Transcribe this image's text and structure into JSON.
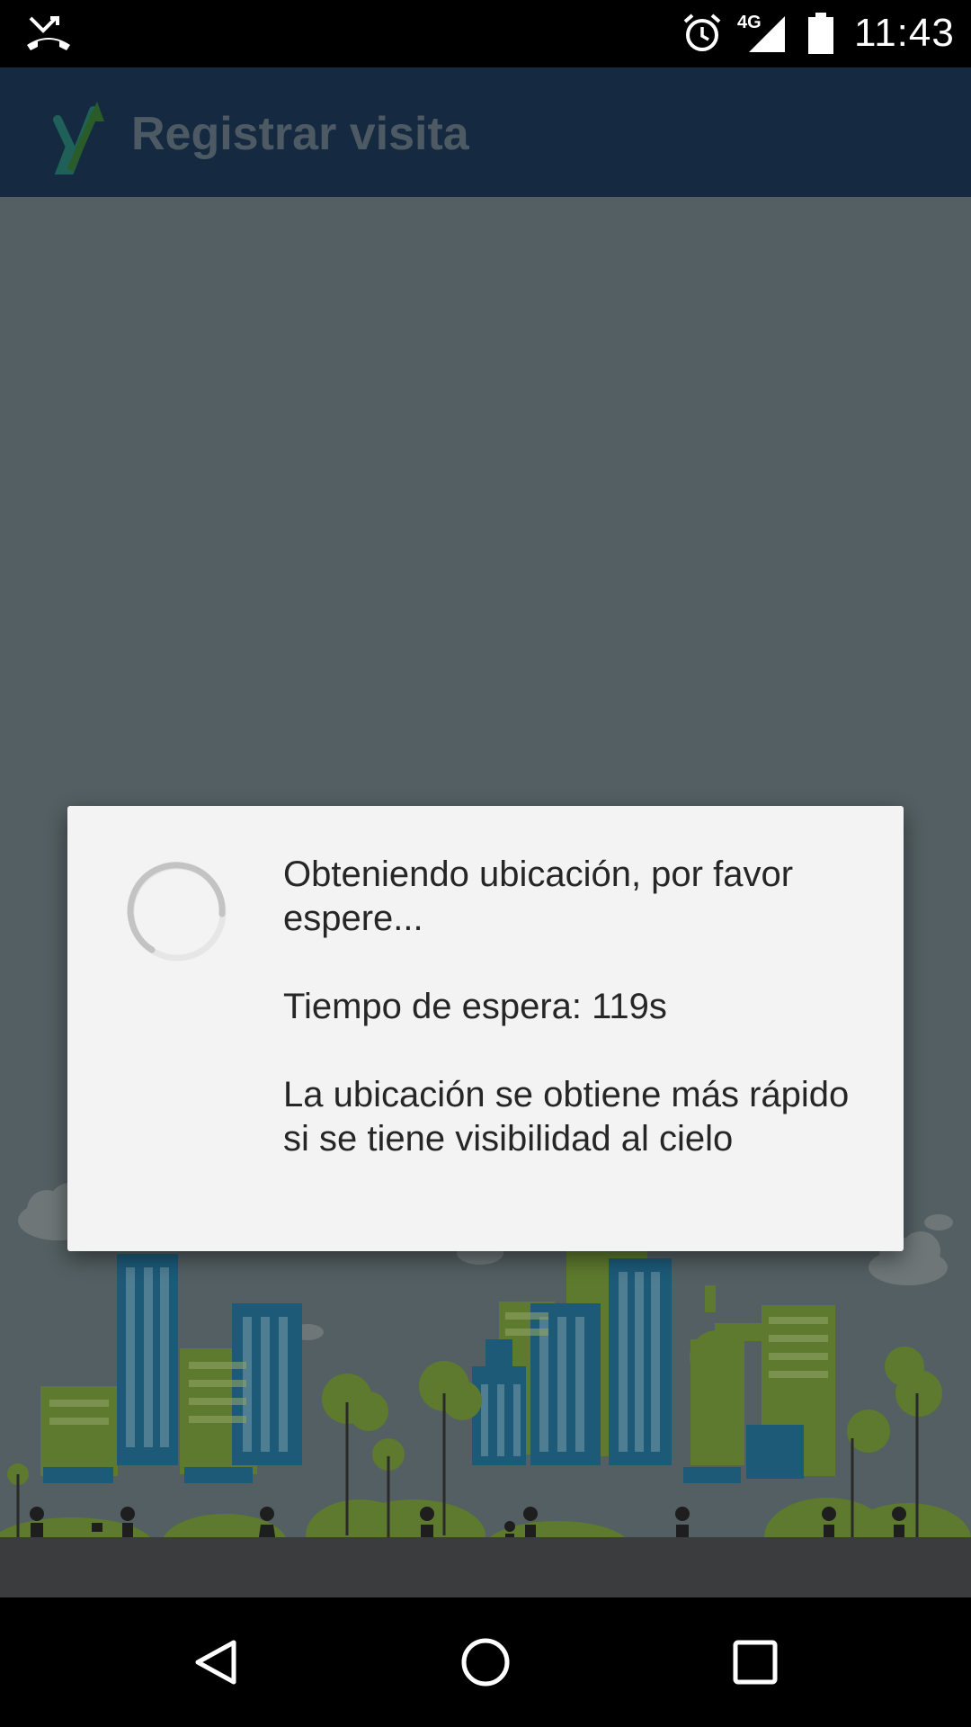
{
  "status_bar": {
    "time": "11:43",
    "network": "4G",
    "icons": [
      "missed-call-icon",
      "alarm-icon",
      "signal-icon",
      "battery-icon"
    ]
  },
  "app_bar": {
    "title": "Registrar visita",
    "logo": "app-logo-icon"
  },
  "dialog": {
    "message": "Obteniendo ubicación, por favor espere...",
    "timeout": "Tiempo de espera: 119s",
    "hint": "La ubicación se obtiene más rápido si se tiene visibilidad al cielo"
  },
  "nav_bar": {
    "icons": [
      "back-icon",
      "home-icon",
      "recents-icon"
    ]
  },
  "colors": {
    "app_bar": "#152a40",
    "content_bg": "#535f62",
    "dialog_bg": "#f3f3f3",
    "ground": "#3b3c3e",
    "building_blue": "#1c5a78",
    "building_green": "#5d7a2e"
  }
}
